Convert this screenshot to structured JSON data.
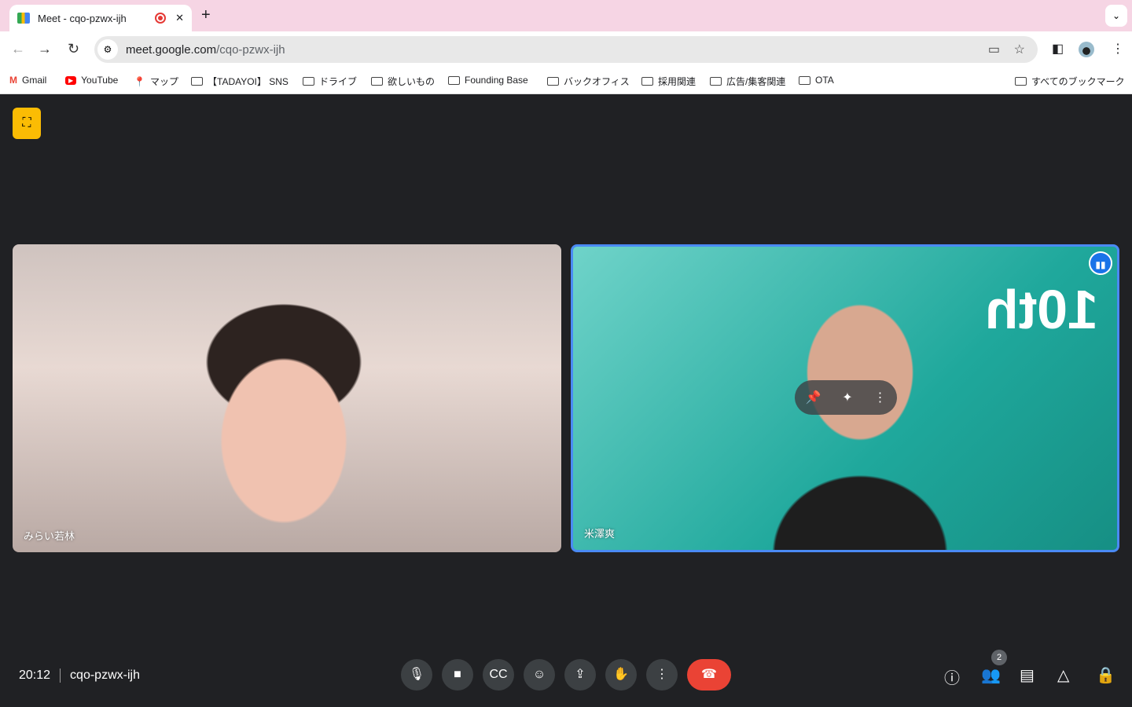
{
  "browser": {
    "tab_title": "Meet - cqo-pzwx-ijh",
    "url_host": "meet.google.com",
    "url_path": "/cqo-pzwx-ijh",
    "bookmarks": [
      "Gmail",
      "YouTube",
      "マップ",
      "【TADAYOI】 SNS",
      "ドライブ",
      "欲しいもの",
      "Founding Base",
      "バックオフィス",
      "採用関連",
      "広告/集客関連",
      "OTA"
    ],
    "all_bookmarks": "すべてのブックマーク"
  },
  "meeting": {
    "time": "20:12",
    "code": "cqo-pzwx-ijh",
    "participant_count": "2",
    "participants": [
      {
        "name": "みらい若林"
      },
      {
        "name": "米澤爽"
      }
    ]
  },
  "colors": {
    "accent": "#4a8af4",
    "end_call": "#ea4335",
    "background": "#202124"
  }
}
